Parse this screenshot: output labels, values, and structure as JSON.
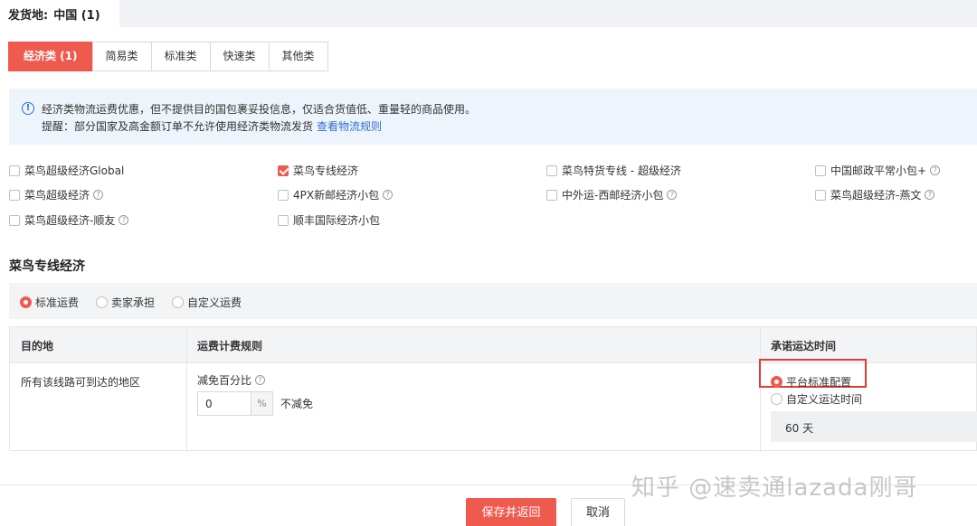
{
  "origin": {
    "label": "发货地:",
    "value": "中国 (1)"
  },
  "tabs": [
    {
      "label": "经济类 (1)",
      "active": true
    },
    {
      "label": "简易类",
      "active": false
    },
    {
      "label": "标准类",
      "active": false
    },
    {
      "label": "快速类",
      "active": false
    },
    {
      "label": "其他类",
      "active": false
    }
  ],
  "notice": {
    "line1": "经济类物流运费优惠，但不提供目的国包裹妥投信息，仅适合货值低、重量轻的商品使用。",
    "line2": "提醒：部分国家及高金额订单不允许使用经济类物流发货",
    "link": "查看物流规则"
  },
  "services": [
    {
      "label": "菜鸟超级经济Global",
      "checked": false,
      "help": false
    },
    {
      "label": "菜鸟专线经济",
      "checked": true,
      "help": false
    },
    {
      "label": "菜鸟特货专线 - 超级经济",
      "checked": false,
      "help": false
    },
    {
      "label": "中国邮政平常小包+",
      "checked": false,
      "help": true
    },
    {
      "label": "菜鸟超级经济",
      "checked": false,
      "help": true
    },
    {
      "label": "4PX新邮经济小包",
      "checked": false,
      "help": true
    },
    {
      "label": "中外运-西邮经济小包",
      "checked": false,
      "help": true
    },
    {
      "label": "菜鸟超级经济-燕文",
      "checked": false,
      "help": true
    },
    {
      "label": "菜鸟超级经济-顺友",
      "checked": false,
      "help": true
    },
    {
      "label": "顺丰国际经济小包",
      "checked": false,
      "help": false
    }
  ],
  "section_title": "菜鸟专线经济",
  "fee_options": [
    {
      "label": "标准运费",
      "selected": true
    },
    {
      "label": "卖家承担",
      "selected": false
    },
    {
      "label": "自定义运费",
      "selected": false
    }
  ],
  "table": {
    "headers": {
      "destination": "目的地",
      "rule": "运费计费规则",
      "promise": "承诺运达时间"
    },
    "destination": "所有该线路可到达的地区",
    "discount_label": "减免百分比",
    "discount_value": "0",
    "discount_unit": "%",
    "no_discount": "不减免",
    "promise_options": [
      {
        "label": "平台标准配置",
        "selected": true
      },
      {
        "label": "自定义运达时间",
        "selected": false
      }
    ],
    "days": "60 天"
  },
  "buttons": {
    "save": "保存并返回",
    "cancel": "取消"
  },
  "watermark": "知乎 @速卖通lazada刚哥",
  "colors": {
    "accent": "#ef5a4f",
    "link": "#2d6fd1",
    "highlight_border": "#e03a33"
  }
}
